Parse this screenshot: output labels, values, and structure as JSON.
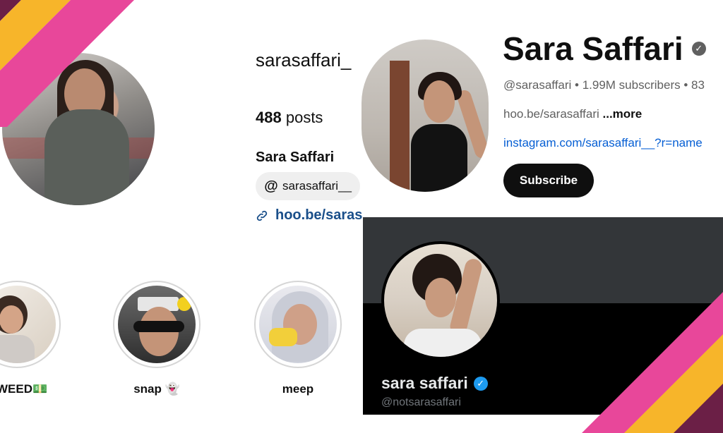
{
  "instagram": {
    "username": "sarasaffari_",
    "posts_count": "488",
    "posts_label": "posts",
    "display_name": "Sara Saffari",
    "threads_handle": "sarasaffari__",
    "link_text": "hoo.be/saras",
    "highlights": [
      {
        "label": "MWEED💵"
      },
      {
        "label": "snap 👻"
      },
      {
        "label": "meep"
      }
    ]
  },
  "youtube": {
    "channel_name": "Sara Saffari",
    "meta": "@sarasaffari • 1.99M subscribers • 83",
    "description": "hoo.be/sarasaffari",
    "more_label": "...more",
    "link": "instagram.com/sarasaffari__?r=name",
    "subscribe_label": "Subscribe"
  },
  "x": {
    "display_name": "sara saffari",
    "handle": "@notsarasaffari"
  },
  "colors": {
    "stripe_pink": "#e8479a",
    "stripe_yellow": "#f7b52a",
    "stripe_purple": "#6b1f46",
    "yt_link": "#065fd4",
    "x_verified": "#1d9bf0"
  }
}
